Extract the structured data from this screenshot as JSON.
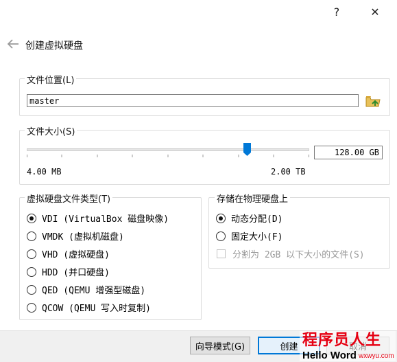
{
  "titlebar": {
    "help": "?",
    "close": "✕"
  },
  "page": {
    "title": "创建虚拟硬盘"
  },
  "location": {
    "group_title": "文件位置(L)",
    "value": "master"
  },
  "size": {
    "group_title": "文件大小(S)",
    "value": "128.00 GB",
    "min_label": "4.00 MB",
    "max_label": "2.00 TB",
    "slider_position_percent": 77
  },
  "disk_type": {
    "group_title": "虚拟硬盘文件类型(T)",
    "options": [
      {
        "label": "VDI (VirtualBox 磁盘映像)",
        "checked": true
      },
      {
        "label": "VMDK (虚拟机磁盘)",
        "checked": false
      },
      {
        "label": "VHD (虚拟硬盘)",
        "checked": false
      },
      {
        "label": "HDD (并口硬盘)",
        "checked": false
      },
      {
        "label": "QED (QEMU 增强型磁盘)",
        "checked": false
      },
      {
        "label": "QCOW (QEMU 写入时复制)",
        "checked": false
      }
    ]
  },
  "storage": {
    "group_title": "存储在物理硬盘上",
    "options": [
      {
        "label": "动态分配(D)",
        "checked": true
      },
      {
        "label": "固定大小(F)",
        "checked": false
      }
    ],
    "split_label": "分割为 2GB 以下大小的文件(S)"
  },
  "buttons": {
    "guided": "向导模式(G)",
    "create": "创建",
    "cancel": "取消"
  },
  "watermark": {
    "line1": "程序员人生",
    "line2": "Hello Word",
    "site": "wxwyu.com"
  },
  "colors": {
    "accent": "#0078d7",
    "watermark_red": "#e60012"
  }
}
